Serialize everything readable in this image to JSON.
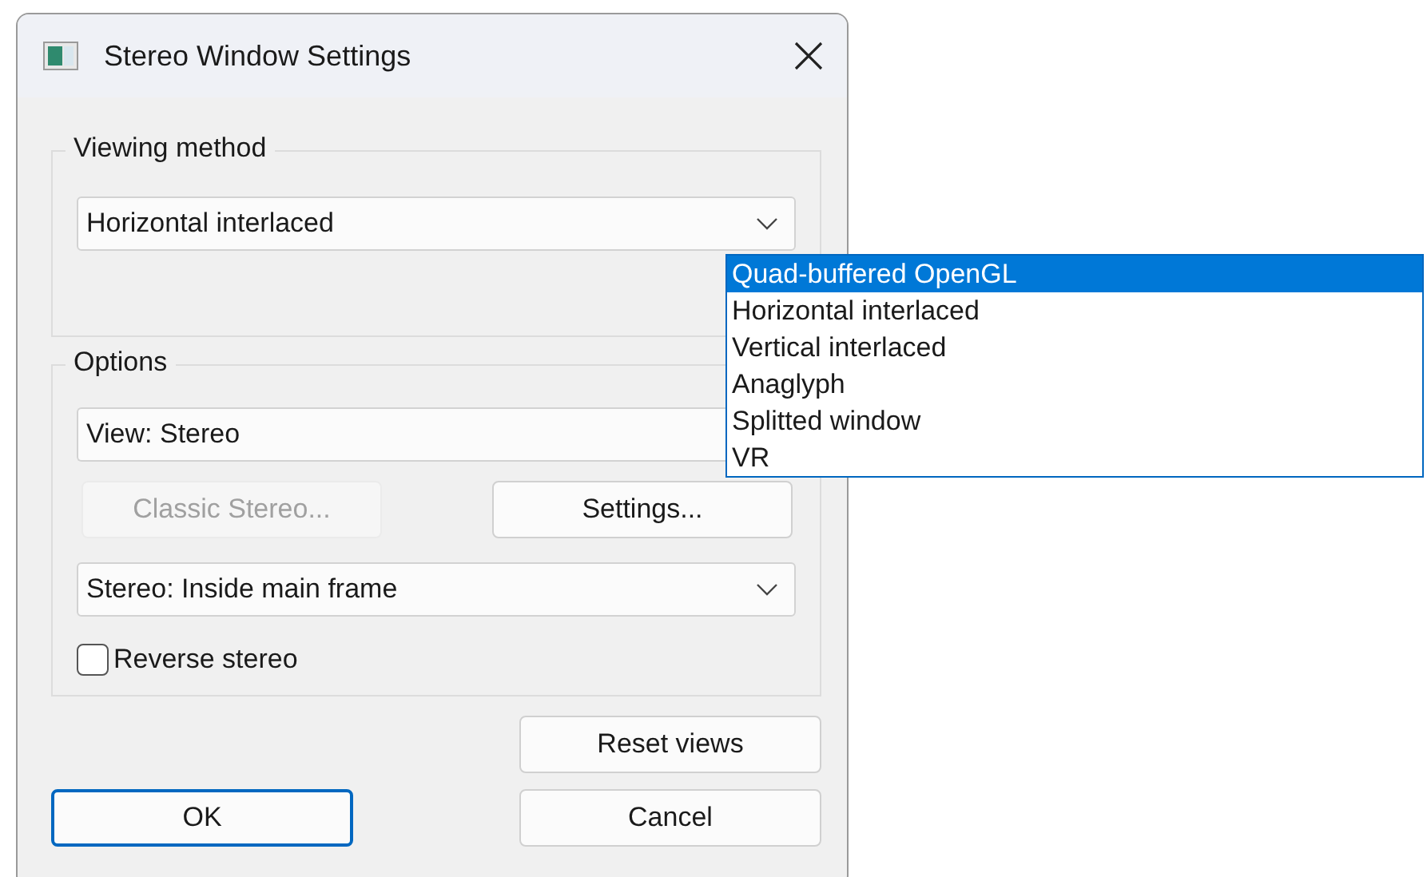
{
  "window": {
    "title": "Stereo Window Settings"
  },
  "viewing_method": {
    "label": "Viewing method",
    "value": "Horizontal interlaced"
  },
  "dropdown_list": [
    {
      "label": "Quad-buffered OpenGL",
      "selected": true
    },
    {
      "label": "Horizontal interlaced",
      "selected": false
    },
    {
      "label": "Vertical interlaced",
      "selected": false
    },
    {
      "label": "Anaglyph",
      "selected": false
    },
    {
      "label": "Splitted window",
      "selected": false
    },
    {
      "label": "VR",
      "selected": false
    }
  ],
  "options": {
    "label": "Options",
    "view": "View: Stereo",
    "buttons": [
      {
        "label": "Classic Stereo...",
        "disabled": true
      },
      {
        "label": "Settings...",
        "disabled": false
      }
    ],
    "stereo": "Stereo: Inside main frame",
    "reverse_stereo": {
      "label": "Reverse stereo",
      "checked": false
    }
  },
  "buttons": [
    {
      "label": "Reset views",
      "default": false
    },
    {
      "label": "OK",
      "default": true
    },
    {
      "label": "Cancel",
      "default": false
    }
  ]
}
